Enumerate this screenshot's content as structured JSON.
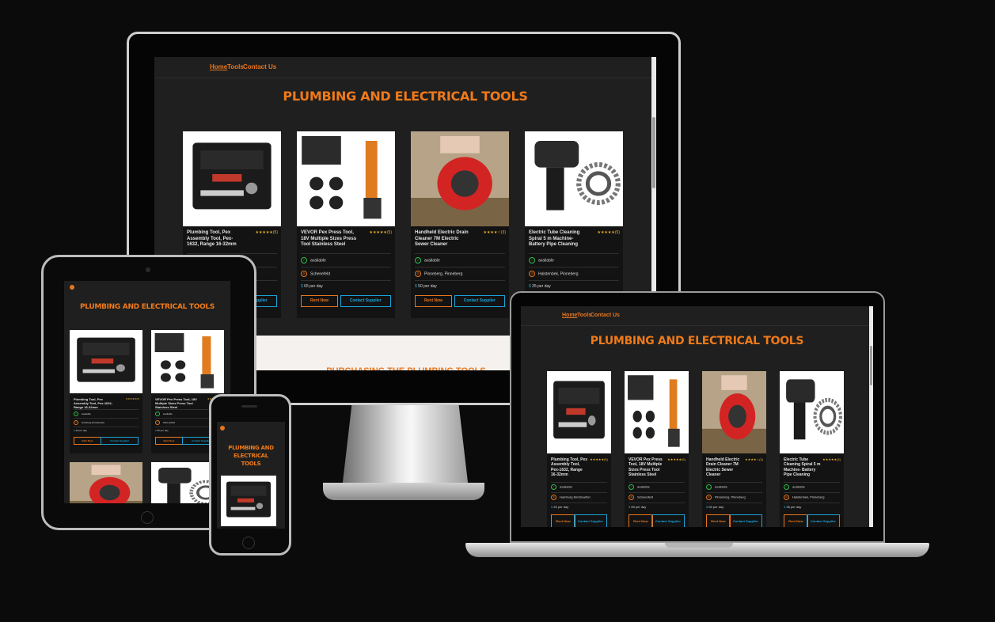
{
  "site": {
    "title": "PLUMBING AND ELECTRICAL TOOLS",
    "nav": {
      "home": "Home",
      "tools": "Tools",
      "contact": "Contact Us"
    }
  },
  "products": [
    {
      "name": "Plumbing Tool, Pex Assembly Tool, Pex-1632, Range 16-32mm",
      "rating": "★★★★★(5)",
      "availability": "available",
      "location": "Hamburg Eimsbuettel",
      "price": "40 per day"
    },
    {
      "name": "VEVOR Pex Press Tool, 18V Multiple Sizes Press Tool Stainless Steel",
      "rating": "★★★★★(5)",
      "availability": "available",
      "location": "Schenefeld",
      "price": "65 per day"
    },
    {
      "name": "Handheld Electric Drain Cleaner 7M Electric Sewer Cleaner",
      "rating": "★★★★☆(3)",
      "availability": "available",
      "location": "Pinneberg, Pinneberg",
      "price": "50 per day"
    },
    {
      "name": "Electric Tube Cleaning Spiral 5 m Machine- Battery Pipe Cleaning",
      "rating": "★★★★★(5)",
      "availability": "available",
      "location": "Halstenbek, Pinneberg",
      "price": "35 per day"
    }
  ],
  "buttons": {
    "rent": "Rent Now",
    "contact": "Contact Supplier"
  },
  "laptop_buttons": {
    "rent": "Rent Now",
    "contact": "Contact Supplier"
  },
  "partial_text": "PURCHASING THE PLUMBING TOOLS",
  "colors": {
    "accent": "#ef7a1a",
    "secondary": "#1aa3d9",
    "ok": "#2fbf4a",
    "star": "#f0b429",
    "site_bg": "#1f1f1f"
  }
}
